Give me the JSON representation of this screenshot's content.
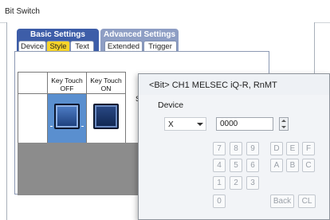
{
  "bit_switch": {
    "title": "Bit Switch",
    "groups": {
      "basic": "Basic Settings",
      "advanced": "Advanced Settings"
    },
    "tabs": [
      {
        "label": "Device",
        "active": false
      },
      {
        "label": "Style",
        "active": true
      },
      {
        "label": "Text",
        "active": false
      },
      {
        "label": "Extended",
        "active": false
      },
      {
        "label": "Trigger",
        "active": false
      }
    ],
    "table": {
      "col_off": "Key Touch OFF",
      "col_on": "Key Touch ON"
    },
    "side_label": "St"
  },
  "device_dialog": {
    "title": "<Bit> CH1 MELSEC iQ-R, RnMT",
    "section_label": "Device",
    "device_type": "X",
    "device_number": "0000",
    "keys": {
      "k7": "7",
      "k8": "8",
      "k9": "9",
      "kD": "D",
      "kE": "E",
      "kF": "F",
      "k4": "4",
      "k5": "5",
      "k6": "6",
      "kA": "A",
      "kB": "B",
      "kC": "C",
      "k1": "1",
      "k2": "2",
      "k3": "3",
      "k0": "0",
      "back": "Back",
      "clear": "CL"
    }
  },
  "colors": {
    "basic_group": "#3d5da8",
    "advanced_group": "#8e9ec4",
    "active_tab": "#f7d42a",
    "selected_cell": "#5a8fcf",
    "key_button": "#1c3d7a"
  }
}
